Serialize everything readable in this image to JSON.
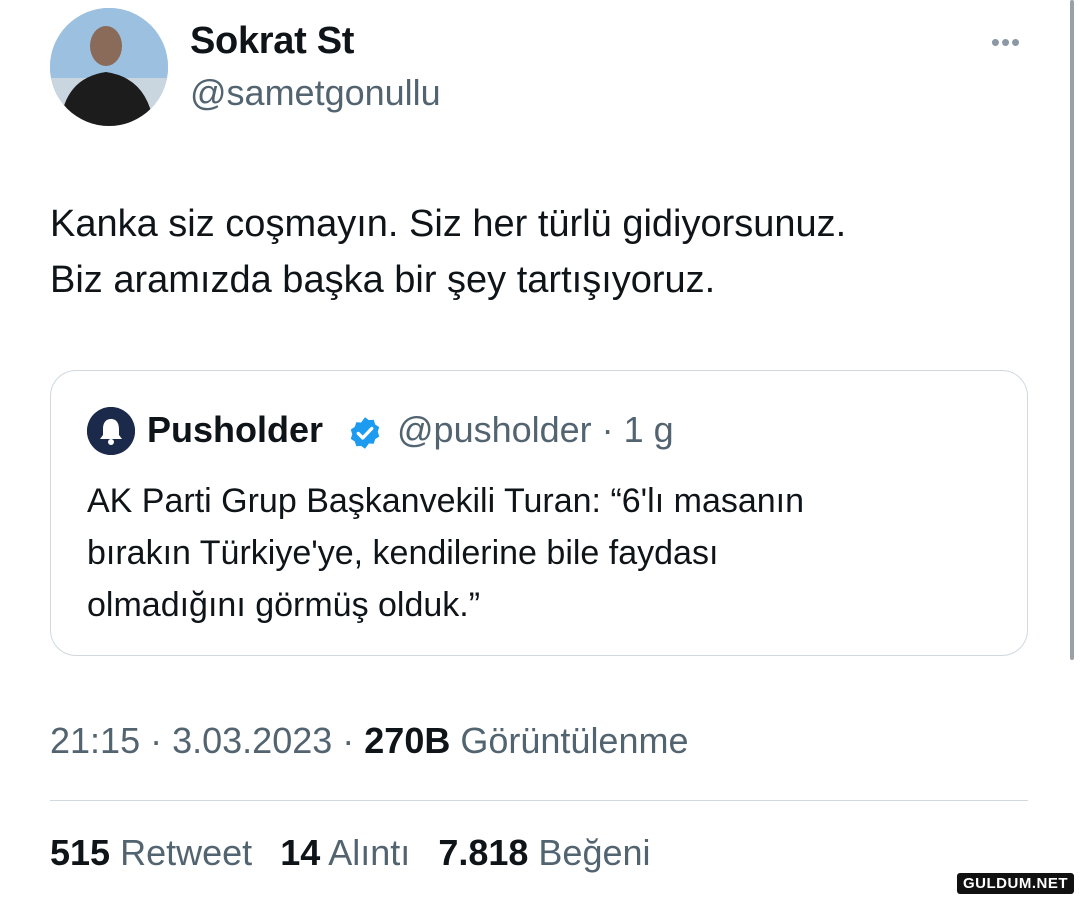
{
  "tweet": {
    "author": {
      "display_name": "Sokrat St",
      "handle": "@sametgonullu"
    },
    "text": "Kanka siz coşmayın. Siz her türlü gidiyorsunuz.\nBiz aramızda başka bir şey tartışıyoruz.",
    "more_icon": "more-horizontal-icon",
    "quoted": {
      "author_name": "Pusholder",
      "verified_icon": "verified-badge-icon",
      "handle_time": "@pusholder · 1 g",
      "text": "AK Parti Grup Başkanvekili Turan: “6'lı masanın\nbırakın Türkiye'ye, kendilerine bile faydası\nolmadığını görmüş olduk.”"
    },
    "meta": {
      "time": "21:15",
      "date": "3.03.2023",
      "views_count": "270B",
      "views_label": "Görüntülenme"
    },
    "stats": {
      "retweets_count": "515",
      "retweets_label": "Retweet",
      "quotes_count": "14",
      "quotes_label": "Alıntı",
      "likes_count": "7.818",
      "likes_label": "Beğeni"
    }
  },
  "watermark": "GULDUM.NET",
  "colors": {
    "text": "#0f1419",
    "secondary": "#536471",
    "border": "#cfd9de",
    "verified": "#1d9bf0"
  }
}
